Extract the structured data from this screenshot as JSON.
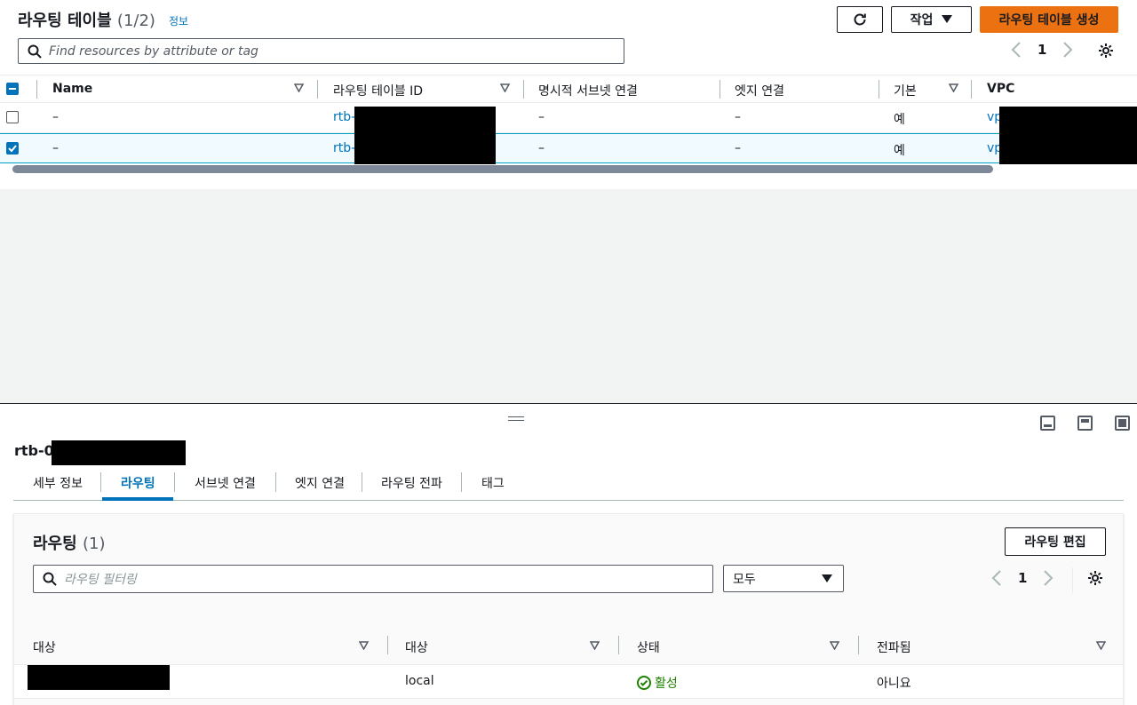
{
  "header": {
    "title": "라우팅 테이블",
    "count": "(1/2)",
    "info_link": "정보",
    "action_button": "작업",
    "create_button": "라우팅 테이블 생성",
    "search_placeholder": "Find resources by attribute or tag",
    "page": "1"
  },
  "table": {
    "columns": [
      "Name",
      "라우팅 테이블 ID",
      "명시적 서브넷 연결",
      "엣지 연결",
      "기본",
      "VPC"
    ],
    "rows": [
      {
        "selected": false,
        "name": "–",
        "id_prefix": "rtb-",
        "subnet": "–",
        "edge": "–",
        "main": "예",
        "vpc_prefix": "vp"
      },
      {
        "selected": true,
        "name": "–",
        "id_prefix": "rtb-",
        "subnet": "–",
        "edge": "–",
        "main": "예",
        "vpc_prefix": "vp"
      }
    ]
  },
  "detail": {
    "title_prefix": "rtb-0",
    "tabs": [
      "세부 정보",
      "라우팅",
      "서브넷 연결",
      "엣지 연결",
      "라우팅 전파",
      "태그"
    ],
    "active_tab": "라우팅"
  },
  "routes": {
    "title": "라우팅",
    "count": "(1)",
    "edit_button": "라우팅 편집",
    "filter_placeholder": "라우팅 필터링",
    "filter_select": "모두",
    "page": "1",
    "columns": [
      "대상",
      "대상",
      "상태",
      "전파됨"
    ],
    "rows": [
      {
        "target": "local",
        "status": "활성",
        "propagated": "아니요"
      }
    ]
  },
  "colors": {
    "primary": "#ec7211",
    "link": "#0073bb",
    "success": "#1d8102"
  }
}
